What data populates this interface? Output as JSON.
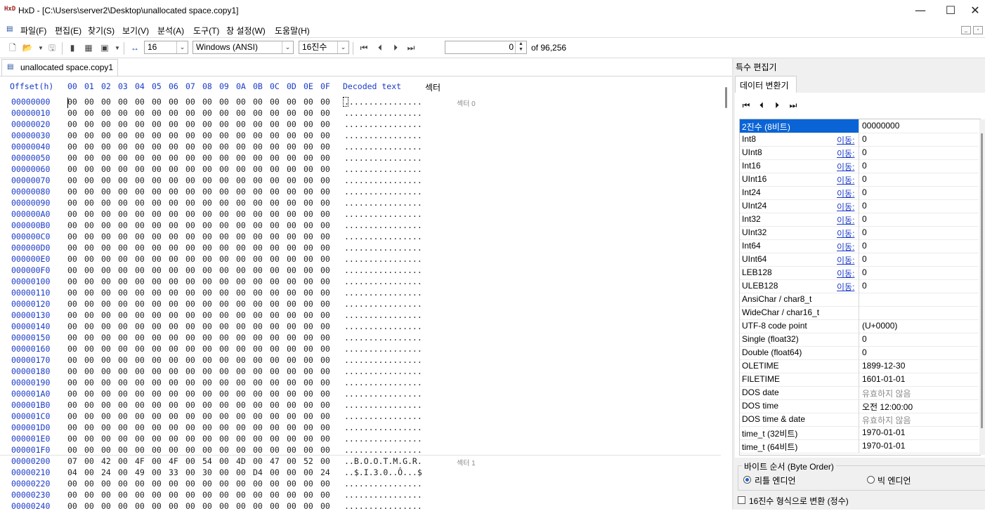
{
  "titlebar": {
    "logo": "HxD",
    "title": "HxD - [C:\\Users\\server2\\Desktop\\unallocated space.copy1]",
    "minimize_glyph": "—",
    "maximize_glyph": "☐",
    "close_glyph": "✕"
  },
  "menu": {
    "items": [
      "파일(F)",
      "편집(E)",
      "찾기(S)",
      "보기(V)",
      "분석(A)",
      "도구(T)",
      "창 설정(W)",
      "도움말(H)"
    ]
  },
  "toolbar": {
    "bytes_per_row": "16",
    "charset": "Windows (ANSI)",
    "offset_base": "16진수",
    "sector_label": "섹터",
    "sector_value": "0",
    "sector_total": "of 96,256",
    "icons": [
      "new-file-icon",
      "open-file-icon",
      "save-icon",
      "disk-icon",
      "ram-icon",
      "file-properties-icon",
      "bytes-per-row-icon",
      "first-sector-icon",
      "prev-sector-icon",
      "next-sector-icon",
      "last-sector-icon"
    ]
  },
  "tab": {
    "label": "unallocated space.copy1"
  },
  "hex": {
    "header_offset": "Offset(h)",
    "header_bytes": [
      "00",
      "01",
      "02",
      "03",
      "04",
      "05",
      "06",
      "07",
      "08",
      "09",
      "0A",
      "0B",
      "0C",
      "0D",
      "0E",
      "0F"
    ],
    "header_decoded": "Decoded text",
    "sector_labels": [
      "섹터 0",
      "섹터 1"
    ],
    "rows": [
      {
        "offset": "00000000",
        "bytes": [
          "00",
          "00",
          "00",
          "00",
          "00",
          "00",
          "00",
          "00",
          "00",
          "00",
          "00",
          "00",
          "00",
          "00",
          "00",
          "00"
        ],
        "text": "................"
      },
      {
        "offset": "00000010",
        "bytes": [
          "00",
          "00",
          "00",
          "00",
          "00",
          "00",
          "00",
          "00",
          "00",
          "00",
          "00",
          "00",
          "00",
          "00",
          "00",
          "00"
        ],
        "text": "................"
      },
      {
        "offset": "00000020",
        "bytes": [
          "00",
          "00",
          "00",
          "00",
          "00",
          "00",
          "00",
          "00",
          "00",
          "00",
          "00",
          "00",
          "00",
          "00",
          "00",
          "00"
        ],
        "text": "................"
      },
      {
        "offset": "00000030",
        "bytes": [
          "00",
          "00",
          "00",
          "00",
          "00",
          "00",
          "00",
          "00",
          "00",
          "00",
          "00",
          "00",
          "00",
          "00",
          "00",
          "00"
        ],
        "text": "................"
      },
      {
        "offset": "00000040",
        "bytes": [
          "00",
          "00",
          "00",
          "00",
          "00",
          "00",
          "00",
          "00",
          "00",
          "00",
          "00",
          "00",
          "00",
          "00",
          "00",
          "00"
        ],
        "text": "................"
      },
      {
        "offset": "00000050",
        "bytes": [
          "00",
          "00",
          "00",
          "00",
          "00",
          "00",
          "00",
          "00",
          "00",
          "00",
          "00",
          "00",
          "00",
          "00",
          "00",
          "00"
        ],
        "text": "................"
      },
      {
        "offset": "00000060",
        "bytes": [
          "00",
          "00",
          "00",
          "00",
          "00",
          "00",
          "00",
          "00",
          "00",
          "00",
          "00",
          "00",
          "00",
          "00",
          "00",
          "00"
        ],
        "text": "................"
      },
      {
        "offset": "00000070",
        "bytes": [
          "00",
          "00",
          "00",
          "00",
          "00",
          "00",
          "00",
          "00",
          "00",
          "00",
          "00",
          "00",
          "00",
          "00",
          "00",
          "00"
        ],
        "text": "................"
      },
      {
        "offset": "00000080",
        "bytes": [
          "00",
          "00",
          "00",
          "00",
          "00",
          "00",
          "00",
          "00",
          "00",
          "00",
          "00",
          "00",
          "00",
          "00",
          "00",
          "00"
        ],
        "text": "................"
      },
      {
        "offset": "00000090",
        "bytes": [
          "00",
          "00",
          "00",
          "00",
          "00",
          "00",
          "00",
          "00",
          "00",
          "00",
          "00",
          "00",
          "00",
          "00",
          "00",
          "00"
        ],
        "text": "................"
      },
      {
        "offset": "000000A0",
        "bytes": [
          "00",
          "00",
          "00",
          "00",
          "00",
          "00",
          "00",
          "00",
          "00",
          "00",
          "00",
          "00",
          "00",
          "00",
          "00",
          "00"
        ],
        "text": "................"
      },
      {
        "offset": "000000B0",
        "bytes": [
          "00",
          "00",
          "00",
          "00",
          "00",
          "00",
          "00",
          "00",
          "00",
          "00",
          "00",
          "00",
          "00",
          "00",
          "00",
          "00"
        ],
        "text": "................"
      },
      {
        "offset": "000000C0",
        "bytes": [
          "00",
          "00",
          "00",
          "00",
          "00",
          "00",
          "00",
          "00",
          "00",
          "00",
          "00",
          "00",
          "00",
          "00",
          "00",
          "00"
        ],
        "text": "................"
      },
      {
        "offset": "000000D0",
        "bytes": [
          "00",
          "00",
          "00",
          "00",
          "00",
          "00",
          "00",
          "00",
          "00",
          "00",
          "00",
          "00",
          "00",
          "00",
          "00",
          "00"
        ],
        "text": "................"
      },
      {
        "offset": "000000E0",
        "bytes": [
          "00",
          "00",
          "00",
          "00",
          "00",
          "00",
          "00",
          "00",
          "00",
          "00",
          "00",
          "00",
          "00",
          "00",
          "00",
          "00"
        ],
        "text": "................"
      },
      {
        "offset": "000000F0",
        "bytes": [
          "00",
          "00",
          "00",
          "00",
          "00",
          "00",
          "00",
          "00",
          "00",
          "00",
          "00",
          "00",
          "00",
          "00",
          "00",
          "00"
        ],
        "text": "................"
      },
      {
        "offset": "00000100",
        "bytes": [
          "00",
          "00",
          "00",
          "00",
          "00",
          "00",
          "00",
          "00",
          "00",
          "00",
          "00",
          "00",
          "00",
          "00",
          "00",
          "00"
        ],
        "text": "................"
      },
      {
        "offset": "00000110",
        "bytes": [
          "00",
          "00",
          "00",
          "00",
          "00",
          "00",
          "00",
          "00",
          "00",
          "00",
          "00",
          "00",
          "00",
          "00",
          "00",
          "00"
        ],
        "text": "................"
      },
      {
        "offset": "00000120",
        "bytes": [
          "00",
          "00",
          "00",
          "00",
          "00",
          "00",
          "00",
          "00",
          "00",
          "00",
          "00",
          "00",
          "00",
          "00",
          "00",
          "00"
        ],
        "text": "................"
      },
      {
        "offset": "00000130",
        "bytes": [
          "00",
          "00",
          "00",
          "00",
          "00",
          "00",
          "00",
          "00",
          "00",
          "00",
          "00",
          "00",
          "00",
          "00",
          "00",
          "00"
        ],
        "text": "................"
      },
      {
        "offset": "00000140",
        "bytes": [
          "00",
          "00",
          "00",
          "00",
          "00",
          "00",
          "00",
          "00",
          "00",
          "00",
          "00",
          "00",
          "00",
          "00",
          "00",
          "00"
        ],
        "text": "................"
      },
      {
        "offset": "00000150",
        "bytes": [
          "00",
          "00",
          "00",
          "00",
          "00",
          "00",
          "00",
          "00",
          "00",
          "00",
          "00",
          "00",
          "00",
          "00",
          "00",
          "00"
        ],
        "text": "................"
      },
      {
        "offset": "00000160",
        "bytes": [
          "00",
          "00",
          "00",
          "00",
          "00",
          "00",
          "00",
          "00",
          "00",
          "00",
          "00",
          "00",
          "00",
          "00",
          "00",
          "00"
        ],
        "text": "................"
      },
      {
        "offset": "00000170",
        "bytes": [
          "00",
          "00",
          "00",
          "00",
          "00",
          "00",
          "00",
          "00",
          "00",
          "00",
          "00",
          "00",
          "00",
          "00",
          "00",
          "00"
        ],
        "text": "................"
      },
      {
        "offset": "00000180",
        "bytes": [
          "00",
          "00",
          "00",
          "00",
          "00",
          "00",
          "00",
          "00",
          "00",
          "00",
          "00",
          "00",
          "00",
          "00",
          "00",
          "00"
        ],
        "text": "................"
      },
      {
        "offset": "00000190",
        "bytes": [
          "00",
          "00",
          "00",
          "00",
          "00",
          "00",
          "00",
          "00",
          "00",
          "00",
          "00",
          "00",
          "00",
          "00",
          "00",
          "00"
        ],
        "text": "................"
      },
      {
        "offset": "000001A0",
        "bytes": [
          "00",
          "00",
          "00",
          "00",
          "00",
          "00",
          "00",
          "00",
          "00",
          "00",
          "00",
          "00",
          "00",
          "00",
          "00",
          "00"
        ],
        "text": "................"
      },
      {
        "offset": "000001B0",
        "bytes": [
          "00",
          "00",
          "00",
          "00",
          "00",
          "00",
          "00",
          "00",
          "00",
          "00",
          "00",
          "00",
          "00",
          "00",
          "00",
          "00"
        ],
        "text": "................"
      },
      {
        "offset": "000001C0",
        "bytes": [
          "00",
          "00",
          "00",
          "00",
          "00",
          "00",
          "00",
          "00",
          "00",
          "00",
          "00",
          "00",
          "00",
          "00",
          "00",
          "00"
        ],
        "text": "................"
      },
      {
        "offset": "000001D0",
        "bytes": [
          "00",
          "00",
          "00",
          "00",
          "00",
          "00",
          "00",
          "00",
          "00",
          "00",
          "00",
          "00",
          "00",
          "00",
          "00",
          "00"
        ],
        "text": "................"
      },
      {
        "offset": "000001E0",
        "bytes": [
          "00",
          "00",
          "00",
          "00",
          "00",
          "00",
          "00",
          "00",
          "00",
          "00",
          "00",
          "00",
          "00",
          "00",
          "00",
          "00"
        ],
        "text": "................"
      },
      {
        "offset": "000001F0",
        "bytes": [
          "00",
          "00",
          "00",
          "00",
          "00",
          "00",
          "00",
          "00",
          "00",
          "00",
          "00",
          "00",
          "00",
          "00",
          "00",
          "00"
        ],
        "text": "................"
      },
      {
        "offset": "00000200",
        "bytes": [
          "07",
          "00",
          "42",
          "00",
          "4F",
          "00",
          "4F",
          "00",
          "54",
          "00",
          "4D",
          "00",
          "47",
          "00",
          "52",
          "00"
        ],
        "text": "..B.O.O.T.M.G.R."
      },
      {
        "offset": "00000210",
        "bytes": [
          "04",
          "00",
          "24",
          "00",
          "49",
          "00",
          "33",
          "00",
          "30",
          "00",
          "00",
          "D4",
          "00",
          "00",
          "00",
          "24"
        ],
        "text": "..$.I.3.0..Ô...$"
      },
      {
        "offset": "00000220",
        "bytes": [
          "00",
          "00",
          "00",
          "00",
          "00",
          "00",
          "00",
          "00",
          "00",
          "00",
          "00",
          "00",
          "00",
          "00",
          "00",
          "00"
        ],
        "text": "................"
      },
      {
        "offset": "00000230",
        "bytes": [
          "00",
          "00",
          "00",
          "00",
          "00",
          "00",
          "00",
          "00",
          "00",
          "00",
          "00",
          "00",
          "00",
          "00",
          "00",
          "00"
        ],
        "text": "................"
      },
      {
        "offset": "00000240",
        "bytes": [
          "00",
          "00",
          "00",
          "00",
          "00",
          "00",
          "00",
          "00",
          "00",
          "00",
          "00",
          "00",
          "00",
          "00",
          "00",
          "00"
        ],
        "text": "................"
      }
    ]
  },
  "inspector": {
    "panel_title": "특수 편집기",
    "tab_label": "데이터 변환기",
    "jump_label": "이동:",
    "rows": [
      {
        "name": "2진수 (8비트)",
        "value": "00000000",
        "jump": false,
        "selected": true
      },
      {
        "name": "Int8",
        "value": "0",
        "jump": true
      },
      {
        "name": "UInt8",
        "value": "0",
        "jump": true
      },
      {
        "name": "Int16",
        "value": "0",
        "jump": true
      },
      {
        "name": "UInt16",
        "value": "0",
        "jump": true
      },
      {
        "name": "Int24",
        "value": "0",
        "jump": true
      },
      {
        "name": "UInt24",
        "value": "0",
        "jump": true
      },
      {
        "name": "Int32",
        "value": "0",
        "jump": true
      },
      {
        "name": "UInt32",
        "value": "0",
        "jump": true
      },
      {
        "name": "Int64",
        "value": "0",
        "jump": true
      },
      {
        "name": "UInt64",
        "value": "0",
        "jump": true
      },
      {
        "name": "LEB128",
        "value": "0",
        "jump": true
      },
      {
        "name": "ULEB128",
        "value": "0",
        "jump": true
      },
      {
        "name": "AnsiChar / char8_t",
        "value": "",
        "jump": false
      },
      {
        "name": "WideChar / char16_t",
        "value": "",
        "jump": false
      },
      {
        "name": "UTF-8 code point",
        "value": " (U+0000)",
        "jump": false
      },
      {
        "name": "Single (float32)",
        "value": "0",
        "jump": false
      },
      {
        "name": "Double (float64)",
        "value": "0",
        "jump": false
      },
      {
        "name": "OLETIME",
        "value": "1899-12-30",
        "jump": false
      },
      {
        "name": "FILETIME",
        "value": "1601-01-01",
        "jump": false
      },
      {
        "name": "DOS date",
        "value": "유효하지 않음",
        "jump": false,
        "muted": true
      },
      {
        "name": "DOS time",
        "value": "오전 12:00:00",
        "jump": false
      },
      {
        "name": "DOS time & date",
        "value": "유효하지 않음",
        "jump": false,
        "muted": true
      },
      {
        "name": "time_t (32비트)",
        "value": "1970-01-01",
        "jump": false
      },
      {
        "name": "time_t (64비트)",
        "value": "1970-01-01",
        "jump": false
      }
    ],
    "byte_order": {
      "title": "바이트 순서 (Byte Order)",
      "little_endian": "리틀 엔디언",
      "big_endian": "빅 엔디언",
      "selected": "little"
    },
    "hex_checkbox_label": "16진수 형식으로 변환 (정수)",
    "hex_checkbox_checked": false
  },
  "colors": {
    "offset_blue": "#1a3ac8",
    "selection_blue": "#0a64d6",
    "muted": "#8a8a8a"
  }
}
